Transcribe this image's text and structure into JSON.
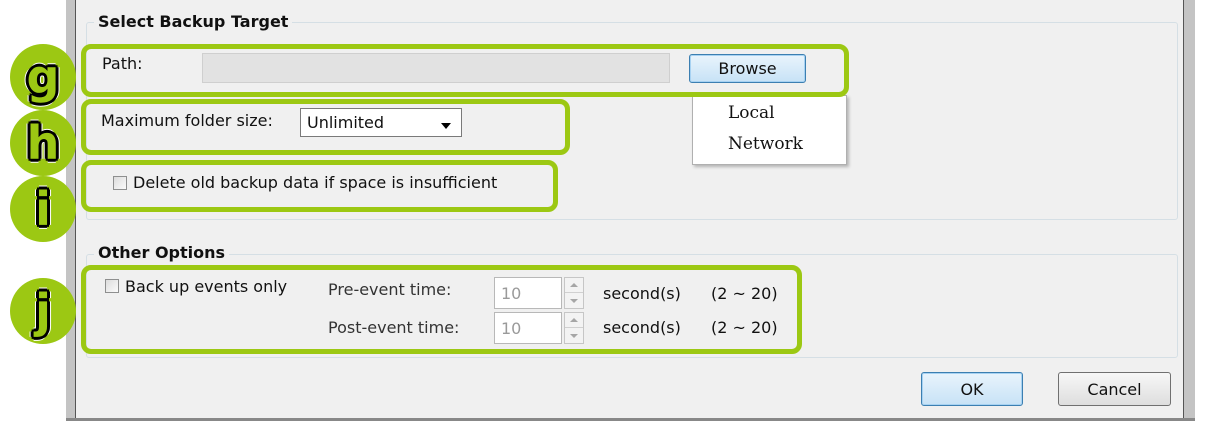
{
  "target_group": {
    "title": "Select Backup Target",
    "path_label": "Path:",
    "path_value": "",
    "browse_label": "Browse",
    "browse_menu": [
      "Local",
      "Network"
    ],
    "max_size_label": "Maximum folder size:",
    "max_size_value": "Unlimited",
    "delete_old_label": "Delete old backup data if space is insufficient",
    "delete_old_checked": false
  },
  "other_group": {
    "title": "Other Options",
    "events_only_label": "Back up events only",
    "events_only_checked": false,
    "pre_event": {
      "label": "Pre-event time:",
      "value": "10",
      "unit": "second(s)",
      "range": "(2 ~ 20)"
    },
    "post_event": {
      "label": "Post-event time:",
      "value": "10",
      "unit": "second(s)",
      "range": "(2 ~ 20)"
    }
  },
  "footer": {
    "ok_label": "OK",
    "cancel_label": "Cancel"
  },
  "callouts": [
    "g",
    "h",
    "i",
    "j"
  ],
  "colors": {
    "callout": "#9cc813",
    "dialog_bg": "#f0f0f0"
  }
}
